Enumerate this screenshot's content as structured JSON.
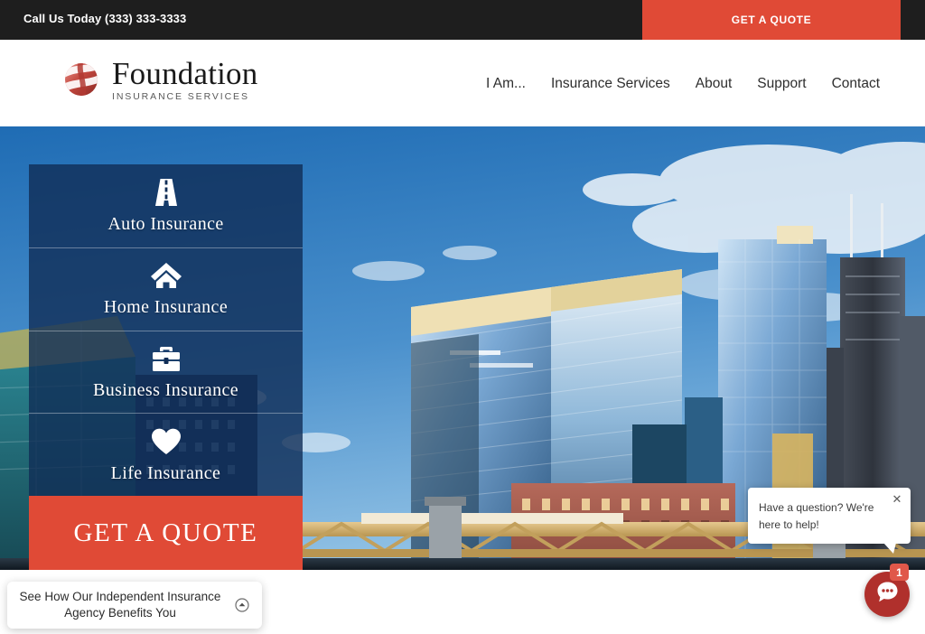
{
  "topbar": {
    "phone_label": "Call Us Today (333) 333-3333",
    "quote_label": "GET A QUOTE",
    "bg_color": "#1e1e1e",
    "accent_color": "#e04a36"
  },
  "header": {
    "logo_title": "Foundation",
    "logo_subtitle": "INSURANCE SERVICES",
    "nav": [
      {
        "label": "I Am..."
      },
      {
        "label": "Insurance Services"
      },
      {
        "label": "About"
      },
      {
        "label": "Support"
      },
      {
        "label": "Contact"
      }
    ]
  },
  "hero": {
    "services": [
      {
        "label": "Auto Insurance",
        "icon": "road-icon"
      },
      {
        "label": "Home Insurance",
        "icon": "house-icon"
      },
      {
        "label": "Business Insurance",
        "icon": "briefcase-icon"
      },
      {
        "label": "Life Insurance",
        "icon": "heart-icon"
      }
    ],
    "cta_label": "GET A QUOTE",
    "panel_color": "#102d56",
    "cta_color": "#e04a36"
  },
  "promo": {
    "text": "See How Our Independent Insurance Agency Benefits You",
    "toggle_icon": "chevron-up-circle-icon"
  },
  "chat": {
    "message": "Have a question? We're here to help!",
    "close_icon": "close-icon",
    "launcher_icon": "chat-bubble-icon",
    "badge_count": "1",
    "launcher_color": "#b0302c",
    "badge_color": "#e0584a"
  }
}
